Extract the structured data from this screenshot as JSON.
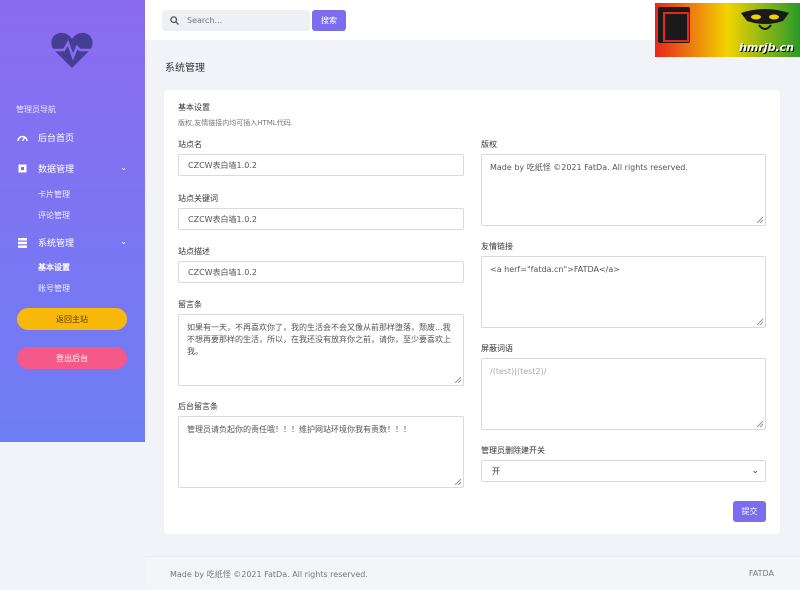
{
  "search": {
    "placeholder": "Search...",
    "button": "搜索"
  },
  "watermark": {
    "text": "hmrjb.cn"
  },
  "sidebar": {
    "heading": "管理员导航",
    "items": [
      {
        "label": "后台首页",
        "icon": "dashboard-icon"
      },
      {
        "label": "数据管理",
        "icon": "square-icon",
        "expandable": true
      },
      {
        "label": "系统管理",
        "icon": "list-icon",
        "expandable": true
      }
    ],
    "data_sub": [
      "卡片管理",
      "评论管理"
    ],
    "system_sub": [
      "基本设置",
      "账号管理"
    ],
    "home_button": "返回主站",
    "logout_button": "登出后台"
  },
  "page": {
    "title": "系统管理"
  },
  "card": {
    "title": "基本设置",
    "subtitle": "版权,友情链接内均可插入HTML代码."
  },
  "form": {
    "site_name": {
      "label": "站点名",
      "value": "CZCW表白墙1.0.2"
    },
    "site_keywords": {
      "label": "站点关键词",
      "value": "CZCW表白墙1.0.2"
    },
    "site_desc": {
      "label": "站点描述",
      "value": "CZCW表白墙1.0.2"
    },
    "message_bar": {
      "label": "留言条",
      "value": "如果有一天，不再喜欢你了，我的生活会不会又像从前那样堕落，颓废...我不想再要那样的生活，所以，在我还没有放弃你之前，请你，至少要喜欢上我。"
    },
    "admin_message": {
      "label": "后台留言条",
      "value": "管理员请负起你的责任哦！！！维护网站环境你我有责数！！！"
    },
    "copyright": {
      "label": "版权",
      "value": "Made by 吃纸怪 ©2021 FatDa. All rights reserved."
    },
    "friend_links": {
      "label": "友情链接",
      "value": "<a herf=\"fatda.cn\">FATDA</a>"
    },
    "blocked_words": {
      "label": "屏蔽词语",
      "placeholder": "/(test)|(test2)/"
    },
    "delete_switch": {
      "label": "管理员删除建开关",
      "value": "开"
    },
    "submit": "提交"
  },
  "footer": {
    "left": "Made by 吃纸怪 ©2021 FatDa. All rights reserved.",
    "right": "FATDA"
  },
  "colors": {
    "accent": "#7b6cf0",
    "home_btn": "#f9b90a",
    "logout_btn": "#f6588a"
  }
}
